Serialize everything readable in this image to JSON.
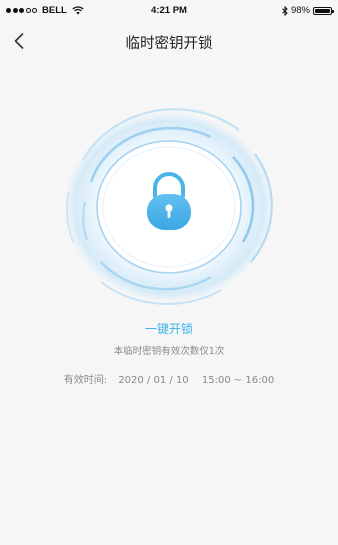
{
  "status_bar": {
    "carrier": "BELL",
    "time": "4:21 PM",
    "battery": "98%",
    "battery_level": 0.98
  },
  "nav": {
    "title": "临时密钥开锁",
    "back_icon": "chevron-left-icon"
  },
  "lock": {
    "icon": "padlock-icon",
    "unlock_label": "一键开锁",
    "hint": "本临时密钥有效次数仅1次"
  },
  "validity": {
    "label": "有效时间:",
    "date": "2020 / 01 / 10",
    "time_range": "15:00 ~ 16:00"
  },
  "colors": {
    "accent": "#3eb1ec",
    "background": "#f6f6f6",
    "lock": "#4cb3ea"
  }
}
